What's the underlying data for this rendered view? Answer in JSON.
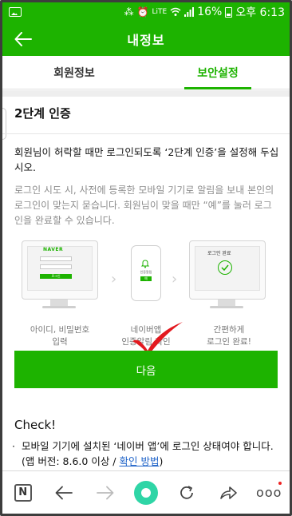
{
  "status_bar": {
    "network": "LiTE",
    "battery": "16%",
    "time": "오후 6:13"
  },
  "header": {
    "title": "내정보"
  },
  "tabs": [
    {
      "label": "회원정보",
      "active": false
    },
    {
      "label": "보안설정",
      "active": true
    }
  ],
  "section": {
    "title": "2단계 인증",
    "description": "회원님이 허락할 때만 로그인되도록 ‘2단계 인증’을 설정해 두십시오.",
    "detail": "로그인 시도 시, 사전에 등록한 모바일 기기로 알림을 보내 본인의 로그인이 맞는지 묻습니다. 회원님이 맞을 때만 “예”를 눌러 로그인을 완료할 수 있습니다."
  },
  "illustration": {
    "naver_logo": "NAVER",
    "login_button": "로그인",
    "phone_text": "인증알림",
    "phone_button": "예",
    "done_label": "로그인 완료",
    "captions": [
      {
        "line1": "아이디, 비밀번호",
        "line2": "입력"
      },
      {
        "line1": "네이버앱",
        "line2": "인증알림 확인"
      },
      {
        "line1": "간편하게",
        "line2": "로그인 완료!"
      }
    ]
  },
  "next_button": "다음",
  "check": {
    "title": "Check!",
    "bullet_text": "모바일 기기에 설치된 ‘네이버 앱’에 로그인 상태여야 합니다. (앱 버전: 8.6.0 이상 / ",
    "bullet_link": "확인 방법",
    "bullet_end": ")"
  },
  "colors": {
    "brand": "#1db300",
    "home_button": "#2fd5a6",
    "annotation_check": "#e3191f"
  },
  "bottom_nav": {
    "icons": [
      "naver-n-icon",
      "back-arrow-icon",
      "forward-arrow-icon",
      "home-circle-icon",
      "refresh-icon",
      "share-icon",
      "more-icon"
    ],
    "logo_letter": "N",
    "more": "ooo"
  }
}
